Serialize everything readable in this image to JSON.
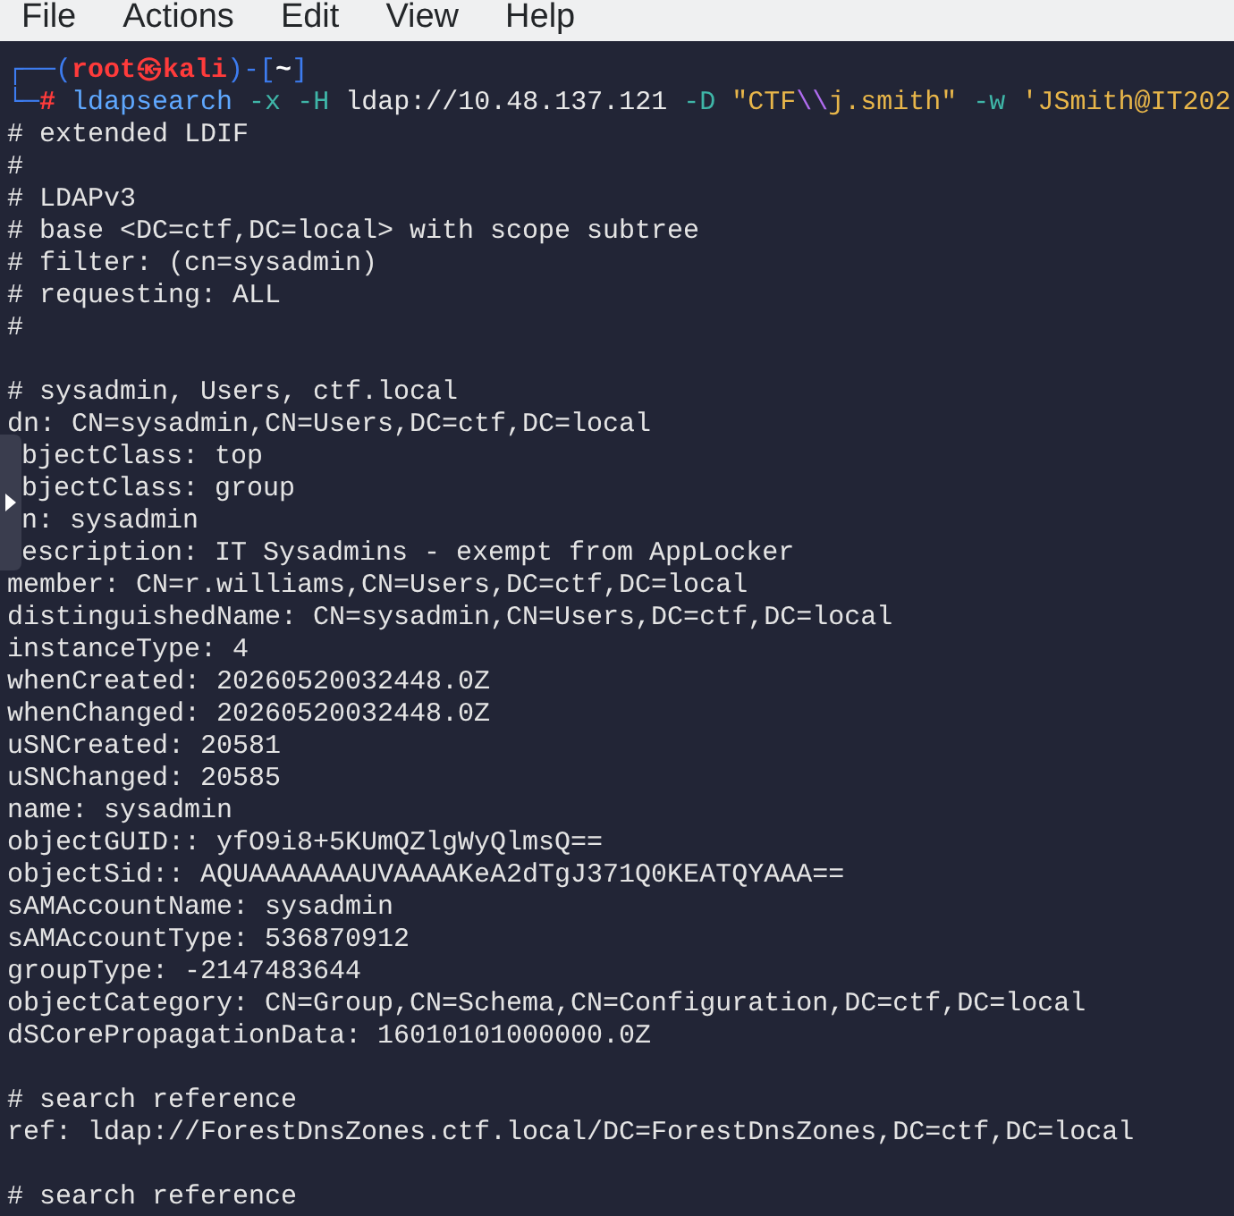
{
  "menu": [
    "File",
    "Actions",
    "Edit",
    "View",
    "Help"
  ],
  "prompt": {
    "open": "┌──(",
    "user_host": "root㉿kali",
    "mid": ")-[",
    "dir": "~",
    "close": "]",
    "corner": "└─",
    "symbol": "#"
  },
  "command": [
    {
      "kind": "program",
      "text": "ldapsearch"
    },
    {
      "kind": "flag",
      "text": "-x"
    },
    {
      "kind": "flag",
      "text": "-H"
    },
    {
      "kind": "plain",
      "text": "ldap://10.48.137.121"
    },
    {
      "kind": "flag",
      "text": "-D"
    },
    {
      "kind": "string",
      "text": "\"CTF"
    },
    {
      "kind": "escape",
      "text": "\\\\"
    },
    {
      "kind": "string",
      "text": "j.smith\""
    },
    {
      "kind": "flag",
      "text": "-w"
    },
    {
      "kind": "string",
      "text": "'JSmith@IT202"
    }
  ],
  "output_blocks": [
    {
      "lines": [
        "# extended LDIF",
        "#",
        "# LDAPv3",
        "# base <DC=ctf,DC=local> with scope subtree",
        "# filter: (cn=sysadmin)",
        "# requesting: ALL",
        "#"
      ]
    },
    {
      "lines": [
        "# sysadmin, Users, ctf.local",
        "dn: CN=sysadmin,CN=Users,DC=ctf,DC=local"
      ],
      "lines_beside_handle": [
        "bjectClass: top",
        "bjectClass: group",
        "n: sysadmin",
        "escription: IT Sysadmins - exempt from AppLocker"
      ],
      "lines_after": [
        "member: CN=r.williams,CN=Users,DC=ctf,DC=local",
        "distinguishedName: CN=sysadmin,CN=Users,DC=ctf,DC=local",
        "instanceType: 4",
        "whenCreated: 20260520032448.0Z",
        "whenChanged: 20260520032448.0Z",
        "uSNCreated: 20581",
        "uSNChanged: 20585",
        "name: sysadmin",
        "objectGUID:: yfO9i8+5KUmQZlgWyQlmsQ==",
        "objectSid:: AQUAAAAAAAUVAAAAKeA2dTgJ371Q0KEATQYAAA==",
        "sAMAccountName: sysadmin",
        "sAMAccountType: 536870912",
        "groupType: -2147483644",
        "objectCategory: CN=Group,CN=Schema,CN=Configuration,DC=ctf,DC=local",
        "dSCorePropagationData: 16010101000000.0Z"
      ]
    },
    {
      "lines": [
        "# search reference",
        "ref: ldap://ForestDnsZones.ctf.local/DC=ForestDnsZones,DC=ctf,DC=local"
      ]
    },
    {
      "lines": [
        "# search reference"
      ]
    }
  ]
}
